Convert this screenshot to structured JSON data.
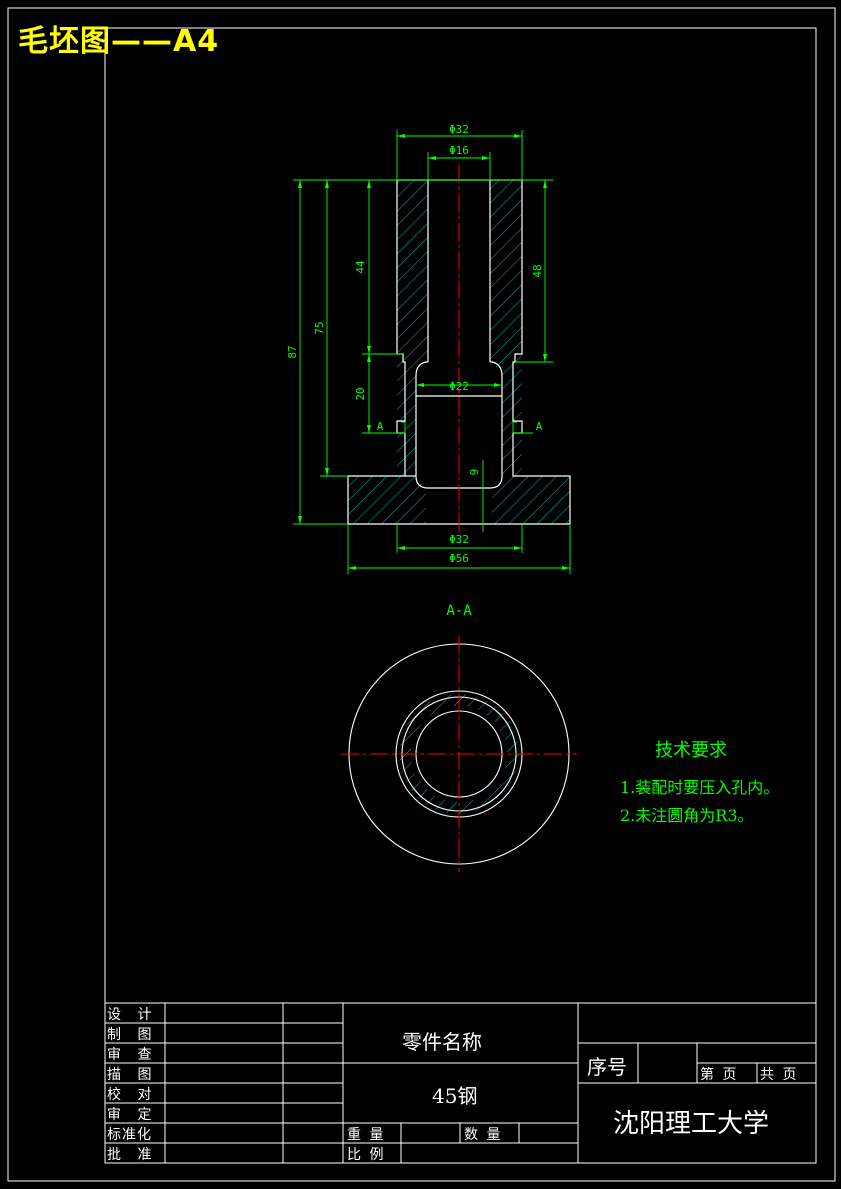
{
  "header": {
    "title": "毛坯图——A4"
  },
  "colors": {
    "outline": "#ffffff",
    "dimension": "#00ff00",
    "centerline": "#ff0000",
    "hatch": "#00c8c8",
    "title": "#ffff00"
  },
  "dimensions": {
    "d_top_outer": "Φ32",
    "d_top_inner": "Φ16",
    "d_cavity": "Φ22",
    "d_bottom_inner": "Φ32",
    "d_base": "Φ56",
    "h_total": "87",
    "h_75": "75",
    "h_44": "44",
    "h_48": "48",
    "h_20": "20",
    "h_9": "9",
    "cut_left": "A",
    "cut_right": "A"
  },
  "section_label": "A-A",
  "tech_requirements": {
    "title": "技术要求",
    "items": [
      "1.装配时要压入孔内。",
      "2.未注圆角为R3。"
    ]
  },
  "title_block": {
    "rows": [
      "设  计",
      "制  图",
      "审  查",
      "描  图",
      "校  对",
      "审  定",
      "标准化",
      "批  准"
    ],
    "part_name_label": "零件名称",
    "material": "45钢",
    "weight_label": "重  量",
    "quantity_label": "数  量",
    "scale_label": "比  例",
    "seq_label": "序号",
    "sheet_label": "第  页",
    "total_label": "共  页",
    "school": "沈阳理工大学"
  }
}
